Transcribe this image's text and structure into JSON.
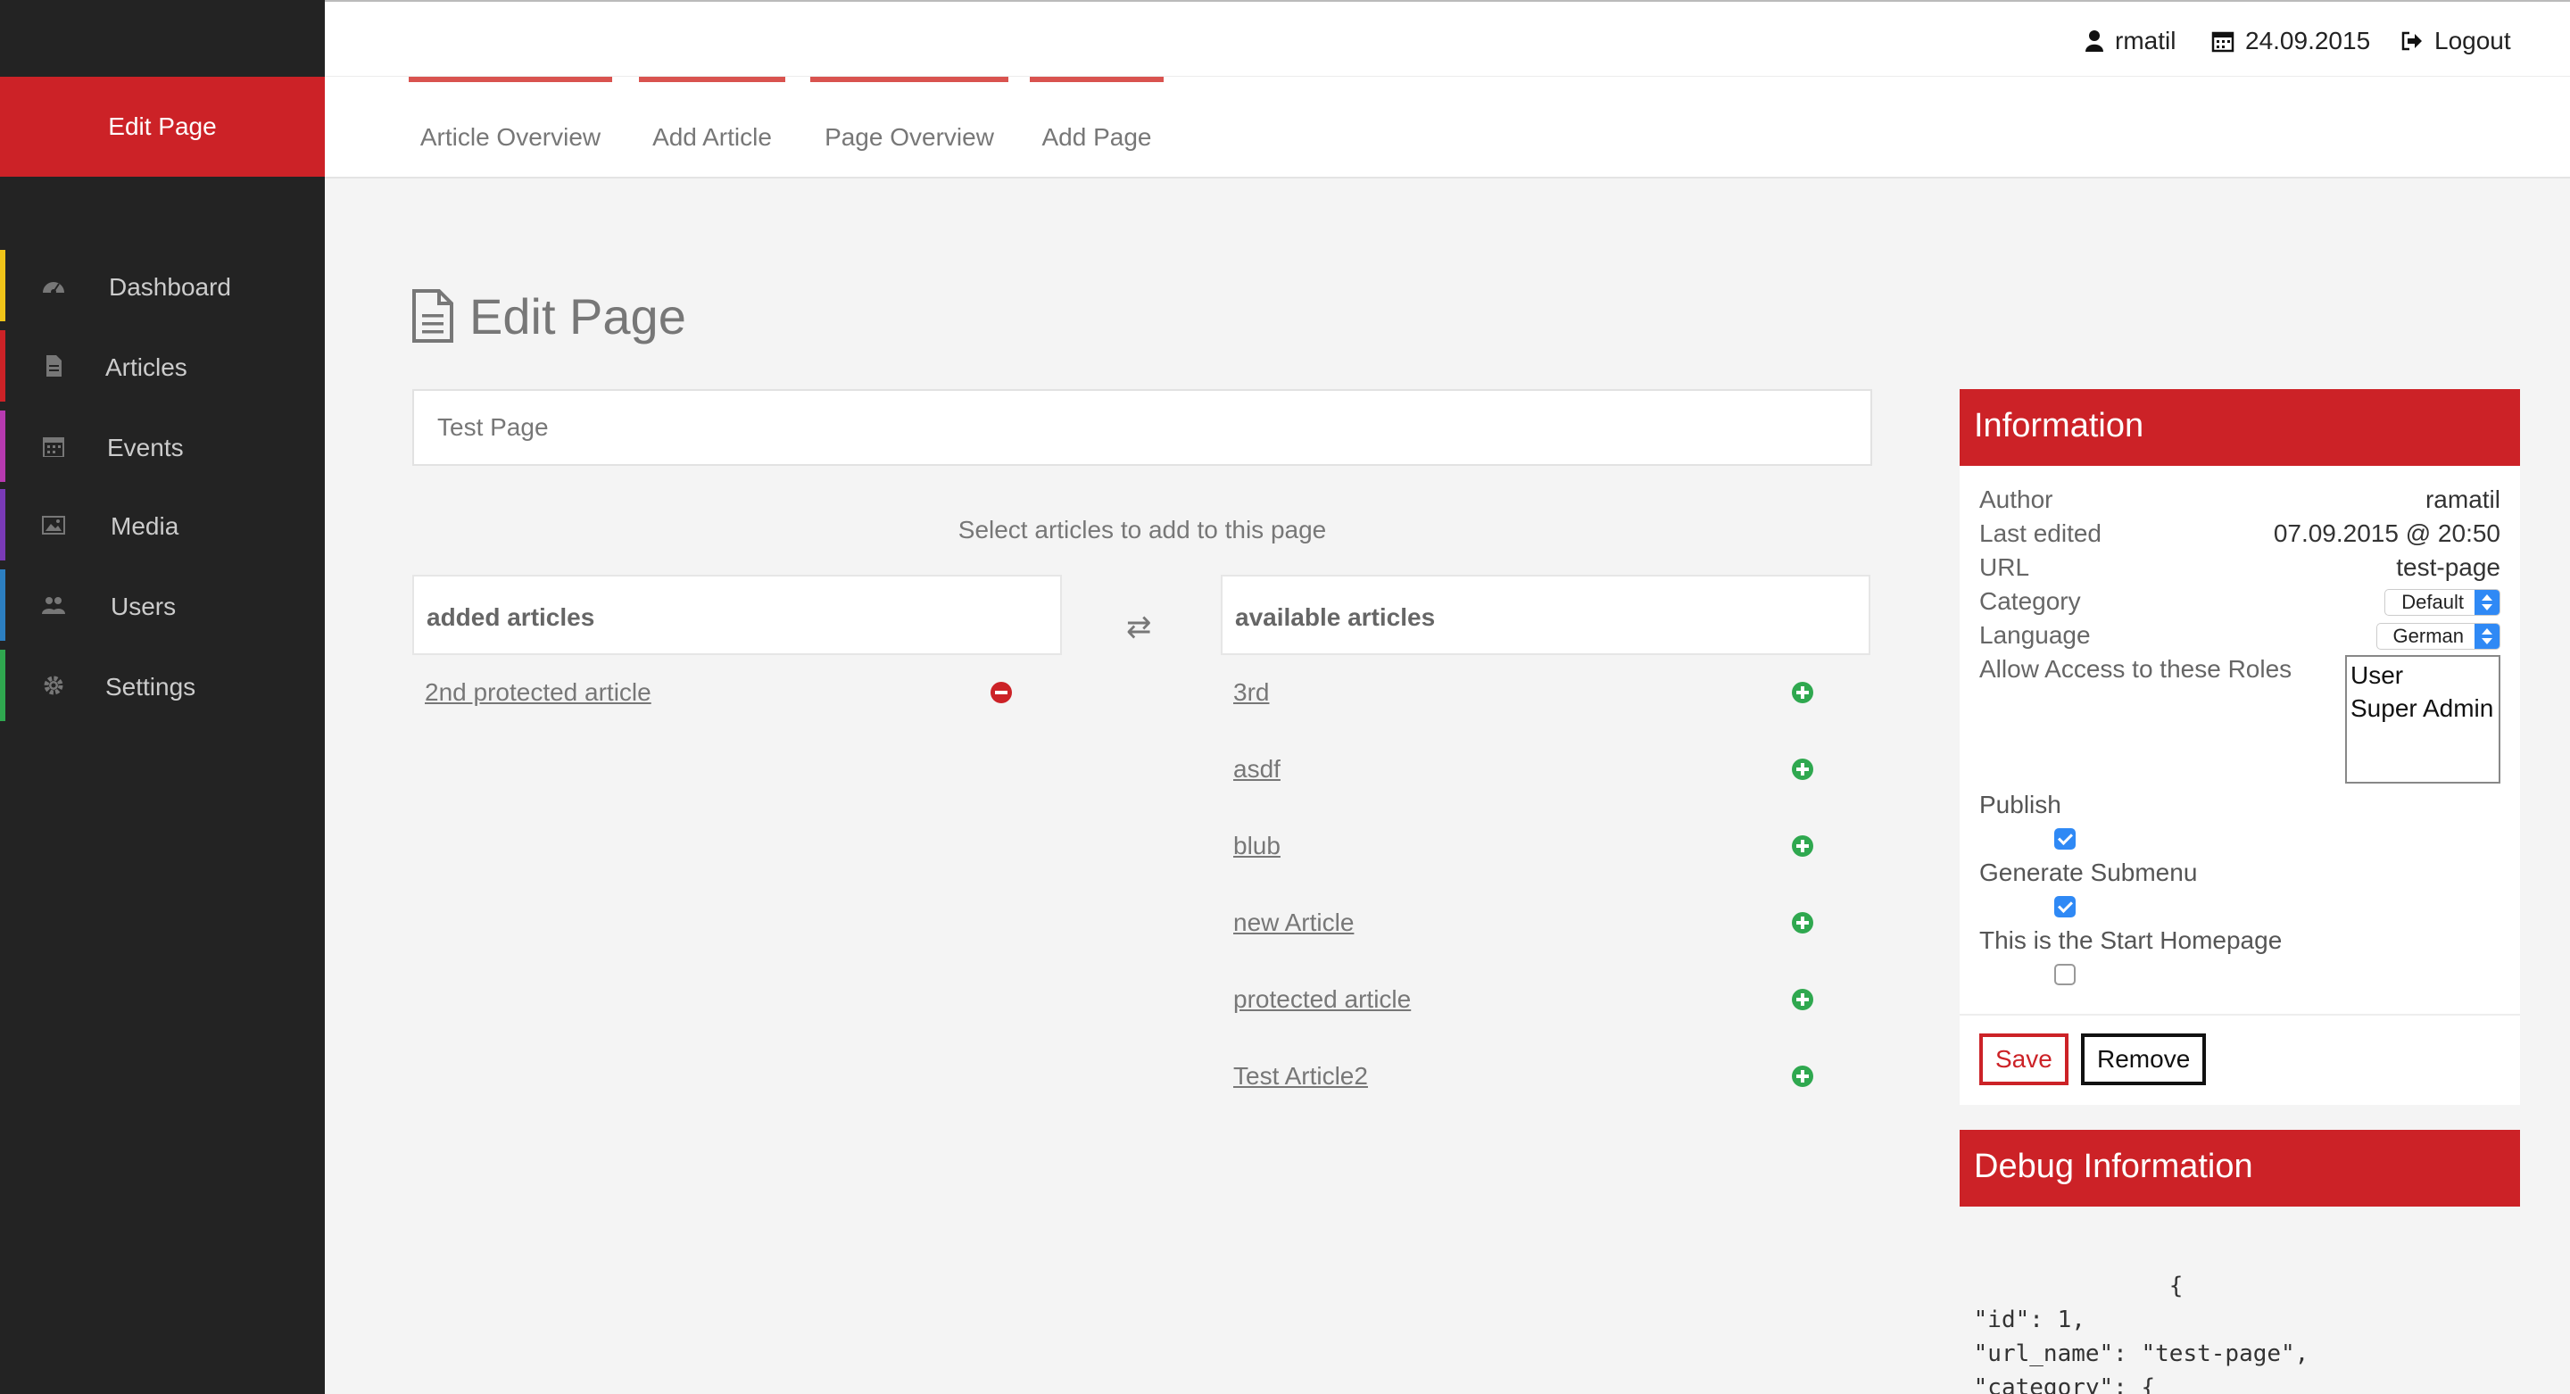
{
  "sidebar": {
    "title": "Edit Page",
    "items": [
      {
        "label": "Dashboard",
        "icon": "dashboard-icon",
        "color": "#f0c419"
      },
      {
        "label": "Articles",
        "icon": "file-icon",
        "color": "#cc2227"
      },
      {
        "label": "Events",
        "icon": "calendar-icon",
        "color": "#b73ab0"
      },
      {
        "label": "Media",
        "icon": "image-icon",
        "color": "#7a3ab7"
      },
      {
        "label": "Users",
        "icon": "users-icon",
        "color": "#2c7fc1"
      },
      {
        "label": "Settings",
        "icon": "gear-icon",
        "color": "#2fa84f"
      }
    ]
  },
  "topbar": {
    "user": "rmatil",
    "date": "24.09.2015",
    "logout": "Logout"
  },
  "subnav": {
    "tabs": [
      "Article Overview",
      "Add Article",
      "Page Overview",
      "Add Page"
    ]
  },
  "main": {
    "title": "Edit Page",
    "title_input_value": "Test Page",
    "select_hint": "Select articles to add to this page",
    "added_header": "added articles",
    "available_header": "available articles",
    "added_articles": [
      "2nd protected article"
    ],
    "available_articles": [
      "3rd",
      "asdf",
      "blub",
      "new Article",
      "protected article",
      "Test Article2"
    ]
  },
  "info": {
    "header": "Information",
    "author_label": "Author",
    "author": "ramatil",
    "edited_label": "Last edited",
    "edited": "07.09.2015 @ 20:50",
    "url_label": "URL",
    "url": "test-page",
    "category_label": "Category",
    "category": "Default",
    "language_label": "Language",
    "language": "German",
    "roles_label": "Allow Access to these Roles",
    "roles": [
      "User",
      "Super Admin"
    ],
    "publish_label": "Publish",
    "publish": true,
    "submenu_label": "Generate Submenu",
    "submenu": true,
    "start_label": "This is the Start Homepage",
    "start": false,
    "save": "Save",
    "remove": "Remove"
  },
  "debug": {
    "header": "Debug Information",
    "code": "               {\n \"id\": 1,\n \"url_name\": \"test-page\",\n \"category\": {"
  },
  "colors": {
    "accent": "#cc2227",
    "sidebar_bg": "#232323",
    "add": "#2fa84f"
  }
}
